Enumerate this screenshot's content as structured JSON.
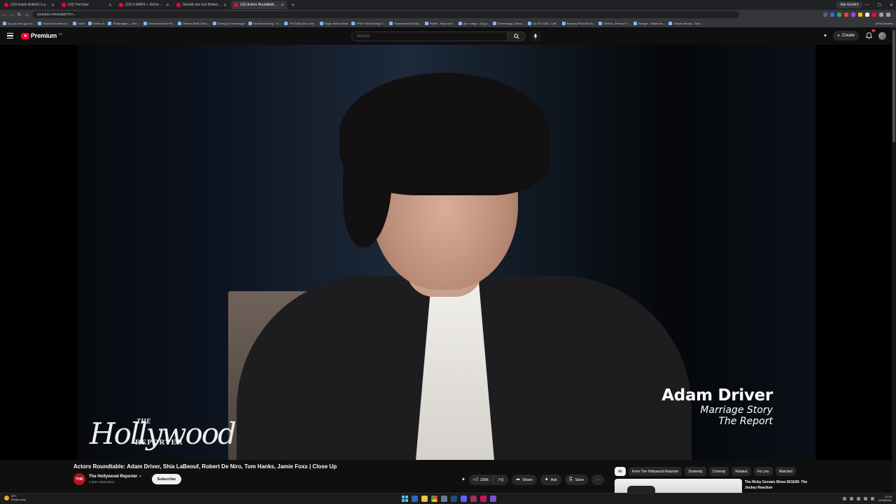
{
  "browser": {
    "tabs": [
      {
        "label": "(10) Inside Anfield | Last 8 ..."
      },
      {
        "label": "(10) YouTube"
      },
      {
        "label": "(10) 4 KAWS + DrDrePlat ft. Tim ..."
      },
      {
        "label": "Should Joe Get Boiled | EP 43 ..."
      },
      {
        "label": "(10) Actors Roundtable: Ad ..."
      }
    ],
    "new_tab": "+",
    "ask_gemini": "Ask Gemini",
    "url": "youtube.com/watch?v=...",
    "bookmarks": [
      "cpu-ps | free gpu wi...",
      "Hacked2 boards on...",
      "reddit",
      "Diablo IV",
      "Postimages — free ...",
      "Premium Deluxe M...",
      "Ableton Multi-Track...",
      "Storage | Framemage",
      "NeoStreamShop - S...",
      "The Daily Grind Job...",
      "Eagle Jersey Store",
      "PFWY Band Songs C...",
      "Scoreboard Overlay...",
      "Reddit - https://ww...",
      "gta v diego - Googl...",
      "Framemage | Mana...",
      "UZ GS 2026 - Cart...",
      "Bombay Pizza By Bo...",
      "GitHub - iPerson77...",
      "Ravage - Watch the...",
      "Games Recap - Gam..."
    ],
    "all_bookmarks": "All Bookmarks"
  },
  "header": {
    "logo_text": "Premium",
    "logo_region": "GB",
    "search_placeholder": "Search",
    "create_label": "Create",
    "notification_count": "9+"
  },
  "video": {
    "title": "Actors Roundtable: Adam Driver, Shia LaBeouf, Robert De Niro, Tom Hanks, Jamie Foxx | Close Up",
    "watermark_the": "THE",
    "watermark_main": "Hollywood",
    "watermark_reporter": "REPORTER",
    "lower_third_name": "Adam Driver",
    "lower_third_line1": "Marriage Story",
    "lower_third_line2": "The Report"
  },
  "channel": {
    "logo_text": "THR",
    "name": "The Hollywood Reporter",
    "subscribers": "1.26m subscribers",
    "subscribe_label": "Subscribe"
  },
  "actions": {
    "likes": "335k",
    "share": "Share",
    "ask": "Ask",
    "save": "Save",
    "more": "···"
  },
  "sidebar": {
    "chips": [
      "All",
      "From The Hollywood Reporter",
      "Dramedy",
      "Comedy",
      "Related",
      "For you",
      "Watched"
    ],
    "recommendation_title": "The Ricky Gervais Show S01E09: The Jockey Reaction"
  },
  "taskbar": {
    "temperature": "20°C",
    "weather": "Mostly sunny",
    "time": "12:29",
    "date": "11/08/2024"
  },
  "colors": {
    "youtube_red": "#ff0033",
    "background": "#0f0f0f",
    "chip": "#272727"
  }
}
